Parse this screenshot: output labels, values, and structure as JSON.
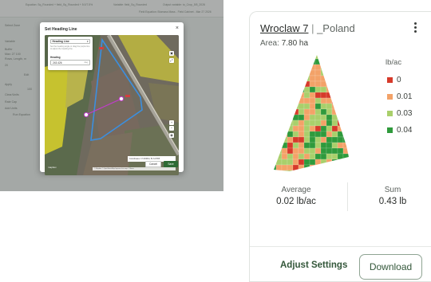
{
  "background_app": {
    "top_items": [
      "Equation: Sq_Rounded + field_Sq_Rounded + 5.0/7.5%",
      "Variable: field_Sq_Rounded",
      "Output variable: to_Crop_5/5_2026",
      "Field Equation: Biomass Mass - Field Cabinet - Mar 27 2026"
    ],
    "side_items": [
      "Select Zone",
      "Variable",
      "Buffer",
      "Max: 27 100",
      "Rows, Length, m",
      "20",
      "Edit",
      "Apply",
      "100",
      "Clear/Units",
      "Rate Cap",
      "Add Units",
      "Run Equation"
    ]
  },
  "modal": {
    "title": "Set Heading Line",
    "close_glyph": "×",
    "panel_header": "Heading Line",
    "panel_description": "Set the heading angle or drag the purple line to adjust the heading line.",
    "heading_label": "Heading",
    "heading_value": "243.426",
    "heading_unit": "deg",
    "coordinates": "Coordinates: 17.003844, 51.617955",
    "credit": "© Mapbox © OpenStreetMap Improve this map © Maxar",
    "map_logo": "mapbox",
    "cancel_label": "Cancel",
    "save_label": "Save",
    "colors": {
      "field_outline": "#3b8fe0",
      "heading_line": "#c03dc9",
      "save": "#2e6b34"
    }
  },
  "card": {
    "field_link": "Wroclaw 7",
    "separator": " | ",
    "country": "_Poland",
    "area_label": "Area:",
    "area_value": "7.80 ha",
    "legend": {
      "title": "lb/ac",
      "items": [
        {
          "label": "0",
          "color": "#d63a2a"
        },
        {
          "label": "0.01",
          "color": "#f3a268"
        },
        {
          "label": "0.03",
          "color": "#a9cf6b"
        },
        {
          "label": "0.04",
          "color": "#2f9a3c"
        }
      ]
    },
    "stats": [
      {
        "label": "Average",
        "value": "0.02 lb/ac"
      },
      {
        "label": "Sum",
        "value": "0.43 lb"
      }
    ],
    "adjust_label": "Adjust Settings",
    "download_label": "Download"
  }
}
